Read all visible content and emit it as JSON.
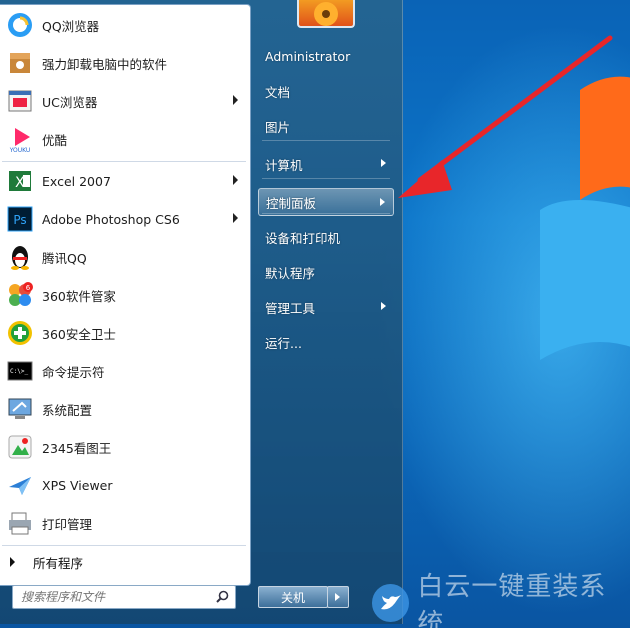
{
  "pinned_programs": [
    {
      "label": "QQ浏览器",
      "icon": "qq-browser-icon",
      "has_submenu": false
    },
    {
      "label": "强力卸载电脑中的软件",
      "icon": "uninstall-box-icon",
      "has_submenu": false
    },
    {
      "label": "UC浏览器",
      "icon": "uc-browser-icon",
      "has_submenu": true
    },
    {
      "label": "优酷",
      "icon": "youku-icon",
      "icon_text": "YOUKU",
      "has_submenu": false
    }
  ],
  "recent_programs": [
    {
      "label": "Excel 2007",
      "icon": "excel-icon",
      "has_submenu": true
    },
    {
      "label": "Adobe Photoshop CS6",
      "icon": "photoshop-icon",
      "icon_text": "Ps",
      "has_submenu": true
    },
    {
      "label": "腾讯QQ",
      "icon": "qq-penguin-icon",
      "has_submenu": false
    },
    {
      "label": "360软件管家",
      "icon": "360-software-manager-icon",
      "icon_text": "6",
      "has_submenu": false
    },
    {
      "label": "360安全卫士",
      "icon": "360-safe-icon",
      "has_submenu": false
    },
    {
      "label": "命令提示符",
      "icon": "command-prompt-icon",
      "icon_text": "C:\\>_",
      "has_submenu": false
    },
    {
      "label": "系统配置",
      "icon": "system-config-icon",
      "has_submenu": false
    },
    {
      "label": "2345看图王",
      "icon": "image-viewer-icon",
      "has_submenu": false
    },
    {
      "label": "XPS Viewer",
      "icon": "xps-viewer-icon",
      "has_submenu": false
    },
    {
      "label": "打印管理",
      "icon": "print-management-icon",
      "has_submenu": false
    }
  ],
  "all_programs_label": "所有程序",
  "search": {
    "placeholder": "搜索程序和文件"
  },
  "right_items": [
    {
      "label": "Administrator",
      "has_submenu": false,
      "highlighted": false
    },
    {
      "label": "文档",
      "has_submenu": false,
      "highlighted": false
    },
    {
      "label": "图片",
      "has_submenu": false,
      "highlighted": false
    },
    {
      "label": "计算机",
      "has_submenu": true,
      "highlighted": false
    },
    {
      "label": "控制面板",
      "has_submenu": true,
      "highlighted": true
    },
    {
      "label": "设备和打印机",
      "has_submenu": false,
      "highlighted": false
    },
    {
      "label": "默认程序",
      "has_submenu": false,
      "highlighted": false
    },
    {
      "label": "管理工具",
      "has_submenu": true,
      "highlighted": false
    },
    {
      "label": "运行...",
      "has_submenu": false,
      "highlighted": false
    }
  ],
  "shutdown_label": "关机",
  "watermark_text": "白云一键重装系统",
  "colors": {
    "accent_arrow": "#e8262a",
    "desktop_blue": "#0c74c8",
    "highlight": "#ffffff"
  }
}
